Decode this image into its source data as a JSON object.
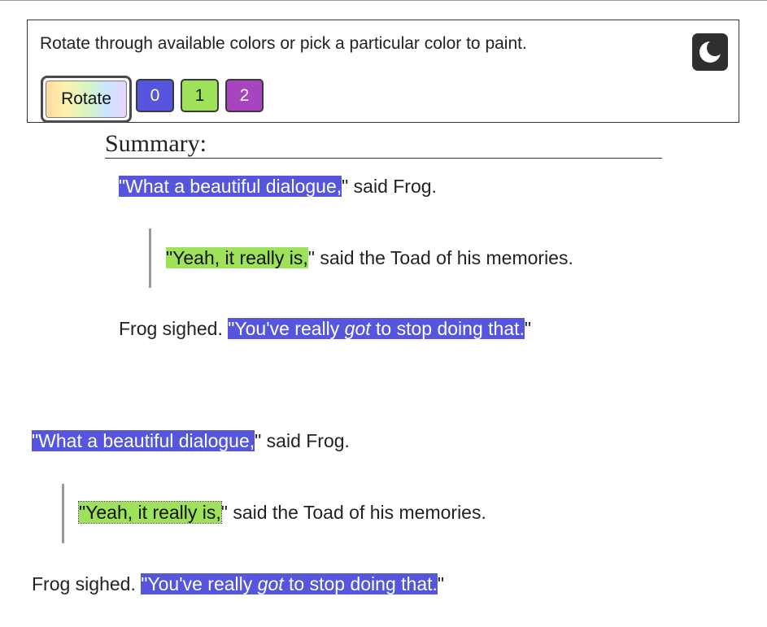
{
  "toolbar": {
    "instructions": "Rotate through available colors or pick a particular color to paint.",
    "rotate_label": "Rotate",
    "color_buttons": [
      {
        "label": "0",
        "color": "#5555dd"
      },
      {
        "label": "1",
        "color": "#9ee25a"
      },
      {
        "label": "2",
        "color": "#a944c0"
      }
    ],
    "theme_toggle_icon": "moon-icon"
  },
  "summary": {
    "title": "Summary:",
    "line1": {
      "quote": "\"What a beautiful dialogue,",
      "rest": "\" said Frog."
    },
    "line2": {
      "quote": "\"Yeah, it really is,",
      "rest": "\" said the Toad of his memories."
    },
    "line3": {
      "prefix": "Frog sighed. ",
      "quote_start": "\"You've really ",
      "quote_em": "got",
      "quote_end": " to stop doing that.",
      "rest": "\""
    }
  },
  "body": {
    "line1": {
      "quote": "\"What a beautiful dialogue,",
      "rest": "\" said Frog."
    },
    "line2": {
      "quote": "\"Yeah, it really is,",
      "rest": "\" said the Toad of his memories."
    },
    "line3": {
      "prefix": "Frog sighed. ",
      "quote_start": "\"You've really ",
      "quote_em": "got",
      "quote_end": " to stop doing that.",
      "rest": "\""
    }
  }
}
